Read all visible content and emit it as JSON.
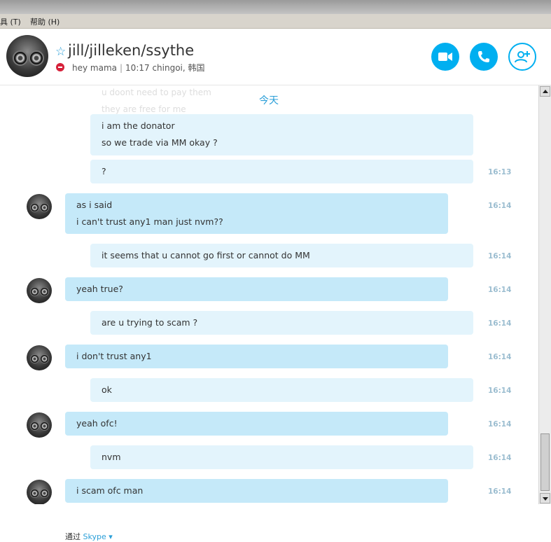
{
  "menu": {
    "tools": "具 (T)",
    "help": "帮助 (H)"
  },
  "contact": {
    "name": "jill/jilleken/ssythe",
    "mood": "hey mama",
    "local_time": "10:17 chingoi, 韩国"
  },
  "header_actions": {
    "video_icon": "video-camera-icon",
    "call_icon": "phone-icon",
    "add_icon": "add-person-icon"
  },
  "chat": {
    "day_label": "今天",
    "faded_lines": [
      "u doont need to pay them",
      "they are free for me"
    ],
    "messages": [
      {
        "dir": "out",
        "lines": [
          "i am the donator",
          "so we trade via MM okay ?"
        ],
        "time": ""
      },
      {
        "dir": "out",
        "lines": [
          "?"
        ],
        "time": "16:13"
      },
      {
        "dir": "in",
        "lines": [
          "as i said",
          "i can't trust any1 man just nvm??"
        ],
        "time": "16:14"
      },
      {
        "dir": "out",
        "lines": [
          "it seems that u cannot go first or cannot do MM"
        ],
        "time": "16:14"
      },
      {
        "dir": "in",
        "lines": [
          "yeah true?"
        ],
        "time": "16:14"
      },
      {
        "dir": "out",
        "lines": [
          "are u trying to scam ?"
        ],
        "time": "16:14"
      },
      {
        "dir": "in",
        "lines": [
          "i don't trust any1"
        ],
        "time": "16:14"
      },
      {
        "dir": "out",
        "lines": [
          "ok"
        ],
        "time": "16:14"
      },
      {
        "dir": "in",
        "lines": [
          "yeah ofc!"
        ],
        "time": "16:14"
      },
      {
        "dir": "out",
        "lines": [
          "nvm"
        ],
        "time": "16:14"
      },
      {
        "dir": "in",
        "lines": [
          "i scam ofc man"
        ],
        "time": "16:14"
      }
    ]
  },
  "footer": {
    "via": "通过",
    "brand": "Skype ▾"
  },
  "colors": {
    "accent": "#00aff0",
    "bubble_out": "#e3f4fc",
    "bubble_in": "#c5e9f9",
    "busy": "#d6213a"
  }
}
